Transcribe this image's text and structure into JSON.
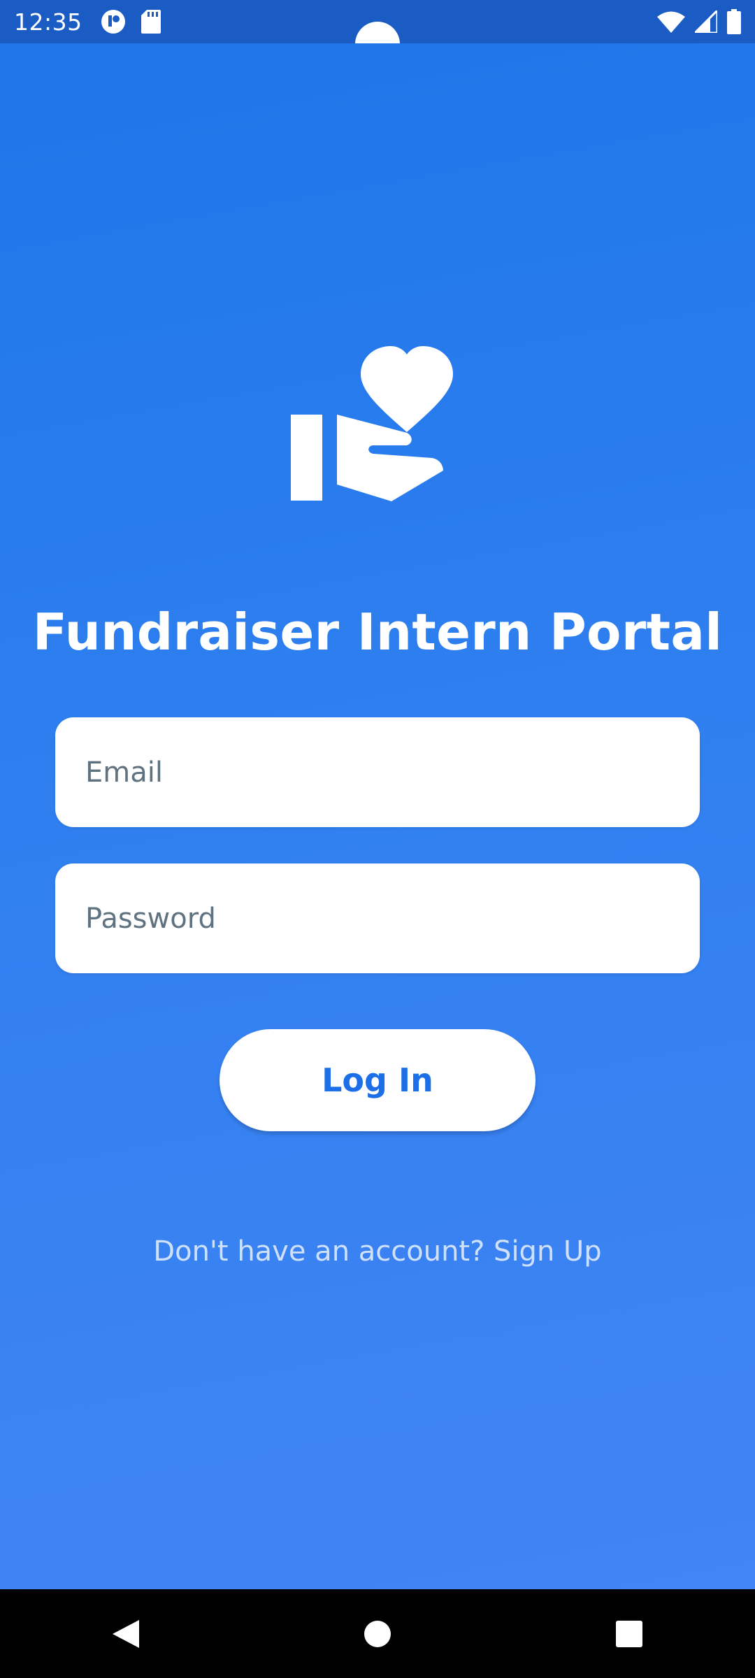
{
  "status_bar": {
    "time": "12:35",
    "icons": [
      "notification-app-icon",
      "sd-card-icon",
      "wifi-icon",
      "cell-signal-icon",
      "battery-icon"
    ]
  },
  "app": {
    "logo_icon": "hand-heart-icon",
    "title": "Fundraiser Intern Portal",
    "email": {
      "placeholder": "Email",
      "value": ""
    },
    "password": {
      "placeholder": "Password",
      "value": ""
    },
    "login_label": "Log In",
    "signup_text": "Don't have an account? Sign Up"
  },
  "nav_bar": {
    "buttons": [
      "back-icon",
      "home-icon",
      "recents-icon"
    ]
  },
  "colors": {
    "gradient_top": "#1e76e8",
    "gradient_bottom": "#4285f4",
    "status_bar": "#1a5cc4",
    "button_text": "#1c6fe6"
  }
}
